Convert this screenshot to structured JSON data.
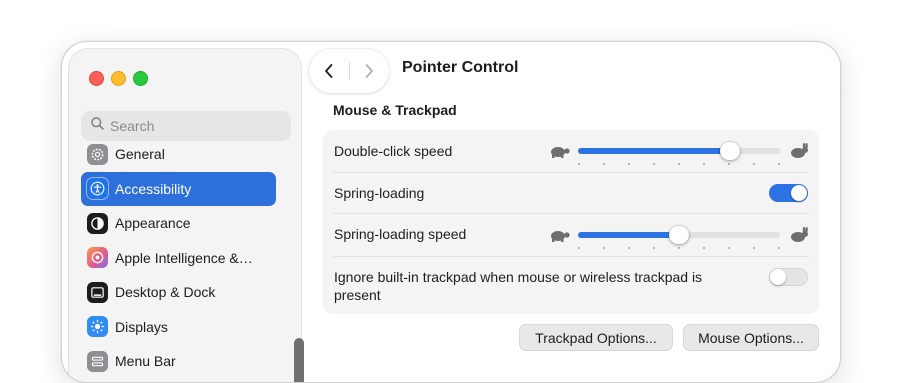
{
  "window": {
    "title": "Pointer Control"
  },
  "search": {
    "placeholder": "Search"
  },
  "sidebar": {
    "items": [
      {
        "label": "General",
        "icon": "gear-icon",
        "selected": false,
        "color": "#8e8e93"
      },
      {
        "label": "Accessibility",
        "icon": "accessibility-icon",
        "selected": true,
        "color": "#1f74e8"
      },
      {
        "label": "Appearance",
        "icon": "appearance-icon",
        "selected": false,
        "color": "#1c1c1e"
      },
      {
        "label": "Apple Intelligence &…",
        "icon": "apple-intelligence-icon",
        "selected": false,
        "color": "#f08a4b"
      },
      {
        "label": "Desktop & Dock",
        "icon": "desktop-dock-icon",
        "selected": false,
        "color": "#1c1c1e"
      },
      {
        "label": "Displays",
        "icon": "displays-icon",
        "selected": false,
        "color": "#2f8cf4"
      },
      {
        "label": "Menu Bar",
        "icon": "menu-bar-icon",
        "selected": false,
        "color": "#8e8e93"
      }
    ]
  },
  "content": {
    "section_title": "Mouse & Trackpad",
    "rows": {
      "double_click_speed": {
        "label": "Double-click speed",
        "value": 0.75
      },
      "spring_loading": {
        "label": "Spring-loading",
        "on": true
      },
      "spring_loading_speed": {
        "label": "Spring-loading speed",
        "value": 0.5
      },
      "ignore_trackpad": {
        "label": "Ignore built-in trackpad when mouse or wireless trackpad is present",
        "on": false
      }
    },
    "buttons": {
      "trackpad_options": "Trackpad Options...",
      "mouse_options": "Mouse Options..."
    }
  },
  "colors": {
    "accent": "#2c72e3",
    "selection": "#2d6fdb"
  }
}
